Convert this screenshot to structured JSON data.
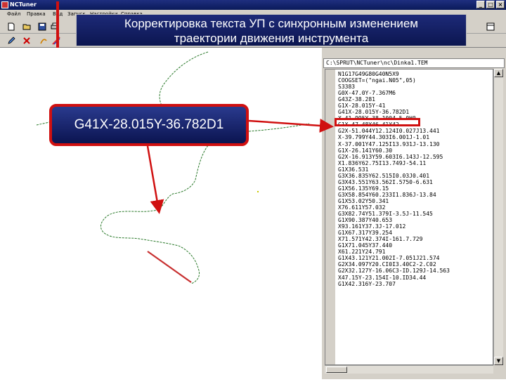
{
  "window": {
    "title": "NCTuner"
  },
  "menu": {
    "items": [
      "Файл",
      "Правка",
      "Вид",
      "Запуск",
      "Настройки",
      "Справка"
    ]
  },
  "slide_title": {
    "line1": "Корректировка текста УП с синхронным изменением",
    "line2": "траектории движения инструмента"
  },
  "callout": {
    "text": "G41X-28.015Y-36.782D1"
  },
  "file_panel": {
    "path": "C:\\SPRUT\\NCTuner\\nc\\Dinka1.TEM",
    "lines": [
      "N1G17G49G80G40N5X9",
      "COOGSET=(\"ngai.N05\",05)",
      "S3383",
      "G0X-47.0Y-7.367M6",
      "G43Z-38.281",
      "G1X-28.015Y-41",
      "G41X-28.015Y-36.782D1",
      "X-41.995Y-38.1004-5.0H0",
      "G1X-47.48Y46.41Y42",
      "G2X-51.044Y12.124I0.027J13.441",
      "X-39.799Y44.303I6.001J-1.01",
      "X-37.001Y47.125I13.931J-13.130",
      "G1X-26.141Y60.30",
      "G2X-16.913Y59.603I6.143J-12.595",
      "X1.836Y62.75I13.749J-54.11",
      "G1X36.531",
      "G3X36.835Y62.515I0.03J0.401",
      "G3X43.551Y63.562I.5750-6.631",
      "G1X56.135Y69.15",
      "G3X58.854Y60.233I1.836J-13.84",
      "G1X53.02Y50.341",
      "X76.611Y57.032",
      "G3X82.74Y51.379I-3.5J-11.545",
      "G1X90.387Y40.653",
      "X93.161Y37.3J-17.012",
      "G1X67.317Y39.254",
      "X71.571Y42.374I-161.7.729",
      "G1X71.045Y37.440",
      "X61.221Y24.791",
      "G1X43.121Y21.002I-7.051J21.574",
      "G2X34.097Y20.CI0I3.40C2-2.C02",
      "G2X32.127Y-16.06C3-ID.129J-14.563",
      "X47.15Y-23.154I-10.ID34.44",
      "G1X42.316Y-23.707"
    ]
  }
}
